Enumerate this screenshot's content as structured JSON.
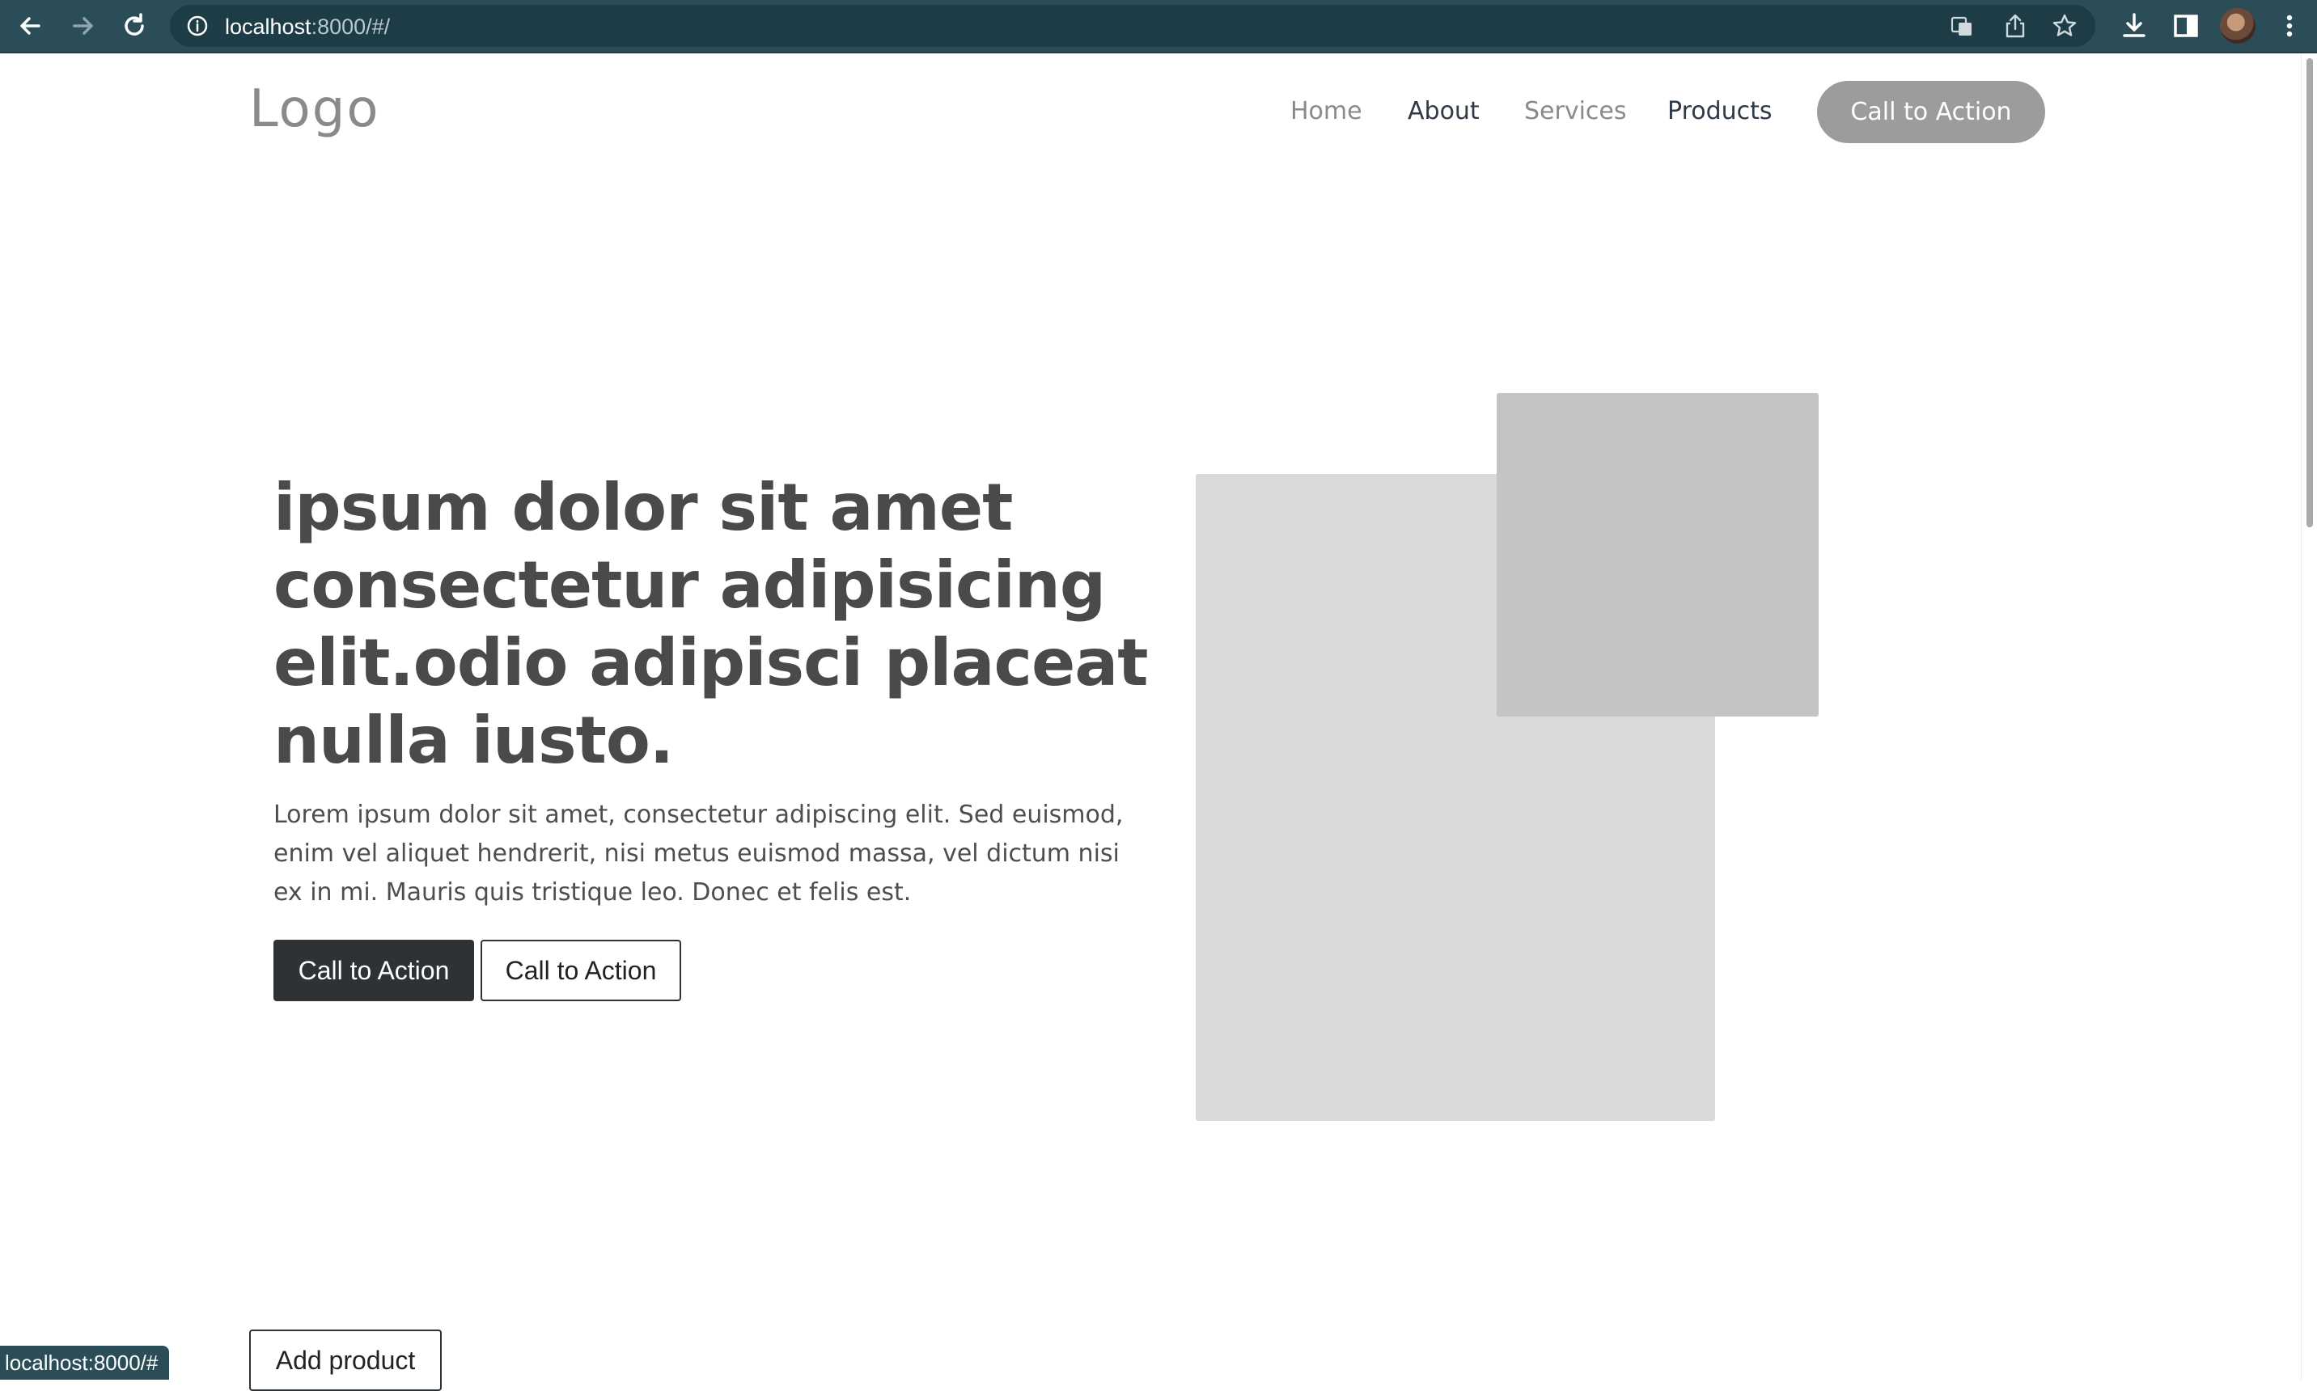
{
  "browser": {
    "url_host": "localhost",
    "url_rest": ":8000/#/",
    "status_url": "localhost:8000/#"
  },
  "nav": {
    "logo": "Logo",
    "links": [
      {
        "label": "Home",
        "color": "#8a8a8a"
      },
      {
        "label": "About",
        "color": "#2f3a48"
      },
      {
        "label": "Services",
        "color": "#8a8a8a"
      },
      {
        "label": "Products",
        "color": "#2f3a48"
      }
    ],
    "cta_label": "Call to Action"
  },
  "hero": {
    "title": "ipsum dolor sit amet consectetur adipisicing elit.odio adipisci placeat nulla iusto.",
    "text": "Lorem ipsum dolor sit amet, consectetur adipiscing elit. Sed euismod, enim vel aliquet hendrerit, nisi metus euismod massa, vel dictum nisi ex in mi. Mauris quis tristique leo. Donec et felis est.",
    "primary_button": "Call to Action",
    "secondary_button": "Call to Action"
  },
  "products": {
    "add_button": "Add product"
  }
}
